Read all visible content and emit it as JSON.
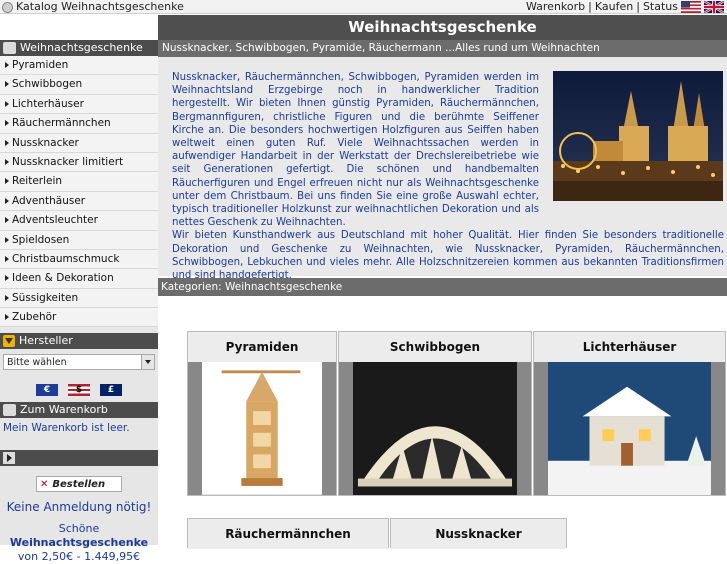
{
  "topbar": {
    "catalog": "Katalog Weihnachtsgeschenke",
    "links": [
      "Warenkorb",
      "Kaufen",
      "Status"
    ],
    "sep": "|"
  },
  "header": {
    "title": "Weihnachtsgeschenke",
    "subtitle": "Nussknacker, Schwibbogen, Pyramide, Räuchermann ...Alles rund um Weihnachten"
  },
  "sidebar": {
    "nav_title": "Weihnachtsgeschenke",
    "items": [
      "Pyramiden",
      "Schwibbogen",
      "Lichterhäuser",
      "Räuchermännchen",
      "Nussknacker",
      "Nussknacker limitiert",
      "Reiterlein",
      "Adventhäuser",
      "Adventsleuchter",
      "Spieldosen",
      "Christbaumschmuck",
      "Ideen & Dekoration",
      "Süssigkeiten",
      "Zubehör"
    ],
    "manufacturer_title": "Hersteller",
    "manufacturer_select": "Bitte wählen",
    "currency": [
      {
        "name": "euro",
        "symbol": "€"
      },
      {
        "name": "dollar",
        "symbol": "$"
      },
      {
        "name": "pound",
        "symbol": "£"
      }
    ],
    "cart_title": "Zum Warenkorb",
    "cart_text": "Mein Warenkorb ist leer.",
    "order_label": "Bestellen",
    "no_login": "Keine Anmeldung nötig!",
    "promo_prefix": "Schöne",
    "promo_bold": "Weihnachtsgeschenke",
    "promo_price": "von 2,50€ - 1.449,95€"
  },
  "intro": {
    "p1": "Nussknacker, Räuchermännchen, Schwibbogen, Pyramiden werden im Weihnachtsland Erzgebirge noch in handwerklicher Tradition hergestellt. Wir bieten Ihnen günstig Pyramiden, Räuchermännchen, Bergmannfiguren, christliche Figuren und die berühmte Seiffener Kirche an. Die besonders hochwertigen Holzfiguren aus Seiffen haben weltweit einen guten Ruf. Viele Weihnachtssachen werden in aufwendiger Handarbeit in der Werkstatt der Drechslereibetriebe wie seit Generationen gefertigt. Die schönen und handbemalten Räucherfiguren und Engel erfreuen nicht nur als Weihnachtsgeschenke unter dem Christbaum. Bei uns finden Sie eine große Auswahl echter, typisch traditioneller Holzkunst zur weihnachtlichen Dekoration und als nettes Geschenk zu Weihnachten.",
    "p2": "Wir bieten Kunsthandwerk aus Deutschland mit hoher Qualität. Hier finden Sie besonders traditionelle Dekoration und Geschenke zu Weihnachten, wie Nussknacker, Pyramiden, Räuchermännchen, Schwibbogen, Lebkuchen und vieles mehr. Alle Holzschnitzereien kommen aus bekannten Traditionsfirmen und sind handgefertigt."
  },
  "categories": {
    "bar_title": "Kategorien: Weihnachtsgeschenke",
    "items": [
      "Pyramiden",
      "Schwibbogen",
      "Lichterhäuser",
      "Räuchermännchen",
      "Nussknacker"
    ]
  },
  "colors": {
    "link": "#1b3a9c",
    "header": "#4f4f4f",
    "subheader": "#6c6c6c"
  }
}
